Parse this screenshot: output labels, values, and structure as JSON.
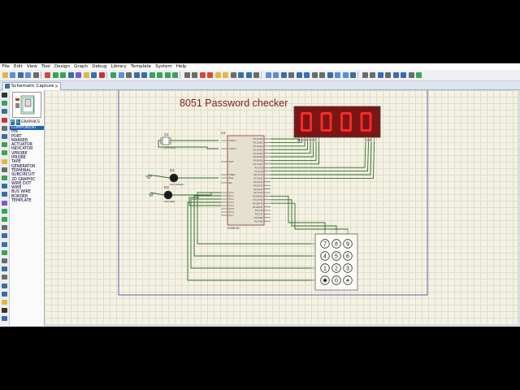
{
  "menus": [
    "File",
    "Edit",
    "View",
    "Tool",
    "Design",
    "Graph",
    "Debug",
    "Library",
    "Template",
    "System",
    "Help"
  ],
  "tab": {
    "label": "Schematic Capture",
    "close": "×"
  },
  "device_panel": {
    "mode_p": "P",
    "mode_l": "L",
    "header": "GRAPHICS",
    "items": [
      "COMPONENT",
      "PIN",
      "PORT",
      "MARKER",
      "ACTUATOR",
      "INDICATOR",
      "VPROBE",
      "IPROBE",
      "TAPE",
      "GENERATOR",
      "TERMINAL",
      "SUBCIRCUIT",
      "2D GRAPHIC",
      "WIRE DOT",
      "WIRE",
      "BUS WIRE",
      "BORDER",
      "TEMPLATE"
    ],
    "selected_index": 0
  },
  "schematic": {
    "title": "8051 Password checker",
    "display_digits": [
      "0",
      "0",
      "0",
      "0"
    ],
    "display_label_left": "ABCDEFG DP",
    "display_label_right": "1234",
    "mcu_ref": "U1",
    "mcu_part": "AT89C51",
    "crystal_ref": "X1",
    "crystal_part": "CRYSTAL",
    "led1_ref": "D1",
    "led1_part": "LED-GREEN",
    "led2_ref": "D2",
    "led2_part": "LED-RED",
    "keypad_keys": [
      "7",
      "8",
      "9",
      "4",
      "5",
      "6",
      "1",
      "2",
      "3",
      "✱",
      "0",
      "#"
    ],
    "mcu_left_pins": [
      "XTAL1",
      "XTAL2",
      "RST",
      "PSEN",
      "ALE",
      "EA",
      "P1.0",
      "P1.1",
      "P1.2",
      "P1.3",
      "P1.4",
      "P1.5",
      "P1.6",
      "P1.7"
    ],
    "mcu_right_pins": [
      "P0.0/AD0",
      "P0.1/AD1",
      "P0.2/AD2",
      "P0.3/AD3",
      "P0.4/AD4",
      "P0.5/AD5",
      "P0.6/AD6",
      "P0.7/AD7",
      "P2.0/A8",
      "P2.1/A9",
      "P2.2/A10",
      "P2.3/A11",
      "P2.4/A12",
      "P2.5/A13",
      "P2.6/A14",
      "P2.7/A15",
      "P3.0/RXD",
      "P3.1/TXD",
      "P3.2/INT0",
      "P3.3/INT1",
      "P3.4/T0",
      "P3.5/T1",
      "P3.6/WR",
      "P3.7/RD"
    ]
  },
  "colors": {
    "segment_on": "#ff2a2a",
    "display_bg": "#7a1616",
    "wire": "#2f6e2f",
    "mcu_fill": "#e6e0d0",
    "body_stroke": "#7a2020",
    "canvas": "#f4f2e4",
    "border_line": "#3a3ab0"
  }
}
